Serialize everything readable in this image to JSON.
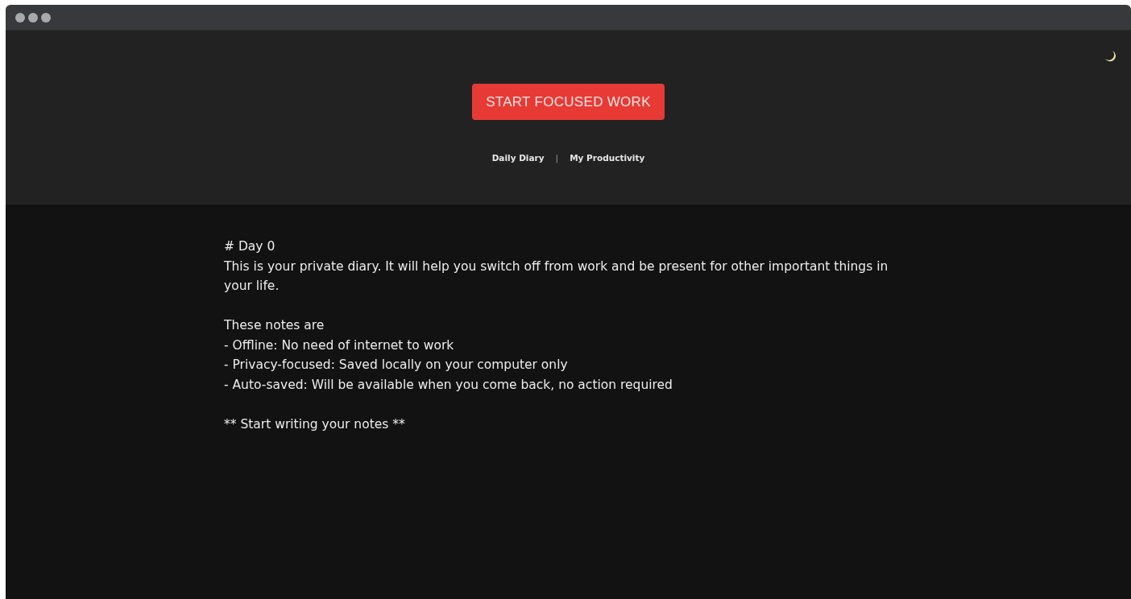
{
  "header": {
    "primary_button": "START FOCUSED WORK",
    "nav_links": [
      {
        "label": "Daily Diary"
      },
      {
        "label": "My Productivity"
      }
    ],
    "nav_separator": "|"
  },
  "editor": {
    "paragraphs": [
      [
        "# Day 0",
        "This is your private diary. It will help you switch off from work and be present for other important things in your life."
      ],
      [
        "These notes are",
        "- Offline: No need of internet to work",
        "- Privacy-focused: Saved locally on your computer only",
        "- Auto-saved: Will be available when you come back, no action required"
      ],
      [
        "** Start writing your notes **"
      ]
    ]
  }
}
